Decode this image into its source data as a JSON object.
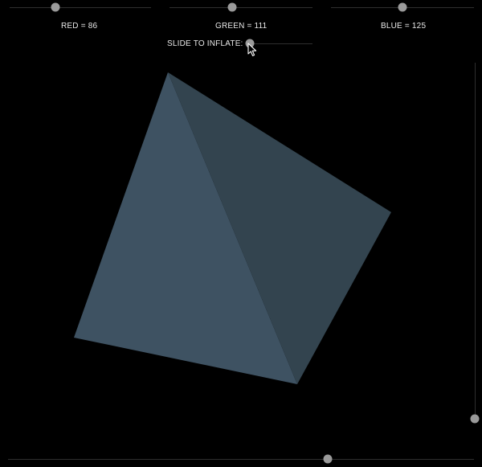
{
  "controls": {
    "red": {
      "label": "RED = 86",
      "value": 86,
      "max": 255
    },
    "green": {
      "label": "GREEN = 111",
      "value": 111,
      "max": 255
    },
    "blue": {
      "label": "BLUE = 125",
      "value": 125,
      "max": 255
    },
    "inflate": {
      "label": "SLIDE TO INFLATE:",
      "value": 0
    },
    "rotate_vertical": {
      "value": 0.0
    },
    "rotate_horizontal": {
      "value": 0.68
    }
  },
  "shape": {
    "name": "tetrahedron",
    "face_color_light": "#3e5262",
    "face_color_dark": "#33444f"
  },
  "colors": {
    "background": "#000000",
    "thumb": "#9a9a9a",
    "track": "#2e2e2e",
    "label": "#e8e8e8"
  }
}
